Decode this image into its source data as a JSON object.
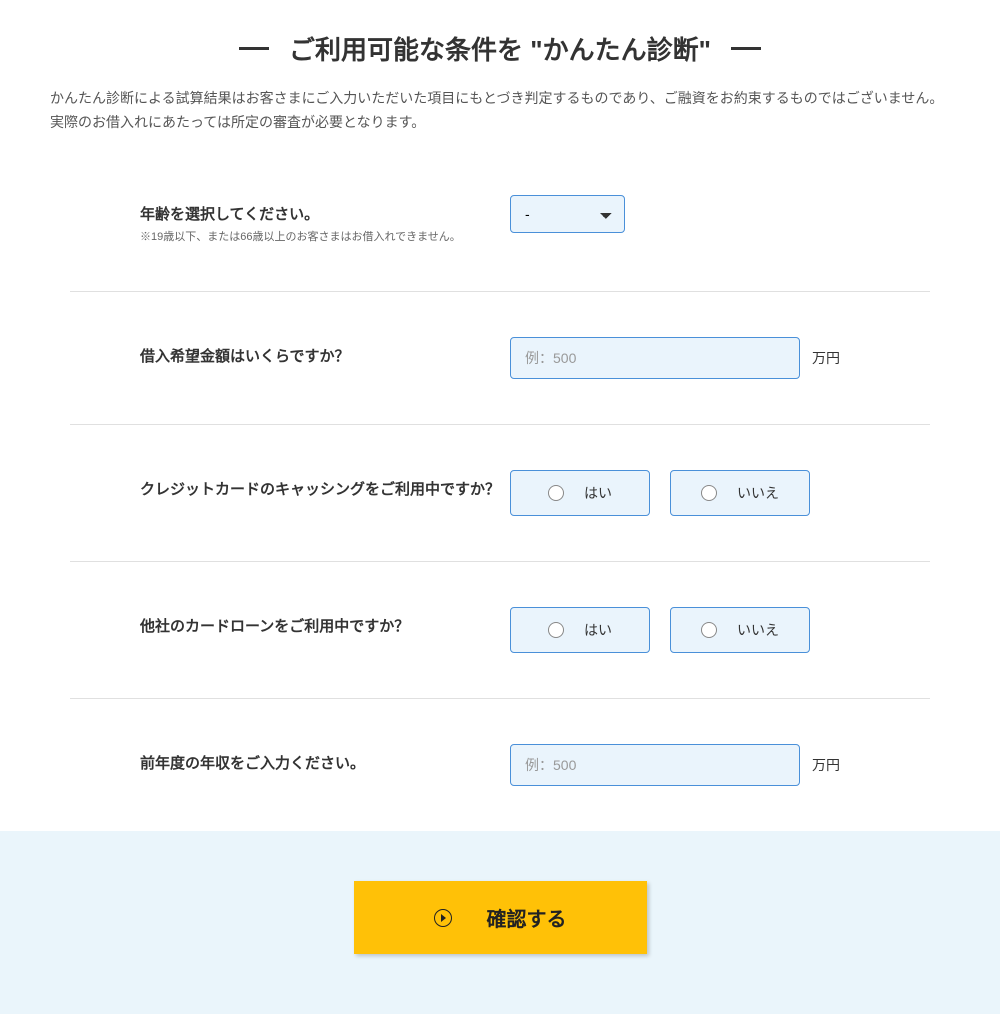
{
  "header": {
    "title": "ご利用可能な条件を \"かんたん診断\""
  },
  "description": "かんたん診断による試算結果はお客さまにご入力いただいた項目にもとづき判定するものであり、ご融資をお約束するものではございません。実際のお借入れにあたっては所定の審査が必要となります。",
  "form": {
    "age": {
      "label": "年齢を選択してください。",
      "note": "※19歳以下、または66歳以上のお客さまはお借入れできません。",
      "selected": "-"
    },
    "amount": {
      "label": "借入希望金額はいくらですか？",
      "placeholder": "例：500",
      "unit": "万円"
    },
    "credit_card": {
      "label": "クレジットカードのキャッシングをご利用中ですか？",
      "options": {
        "yes": "はい",
        "no": "いいえ"
      }
    },
    "other_loan": {
      "label": "他社のカードローンをご利用中ですか？",
      "options": {
        "yes": "はい",
        "no": "いいえ"
      }
    },
    "income": {
      "label": "前年度の年収をご入力ください。",
      "placeholder": "例：500",
      "unit": "万円"
    }
  },
  "footer": {
    "submit_label": "確認する"
  }
}
